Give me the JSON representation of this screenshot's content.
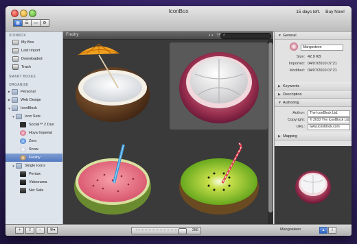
{
  "window": {
    "title": "IconBox",
    "trial_text": "15 days left.",
    "buy_label": "Buy Now!"
  },
  "toolbar": {
    "buttons": [
      "view-grid",
      "view-list",
      "view-cover",
      "settings"
    ]
  },
  "sidebar": {
    "library_header": "ICONBOX",
    "library_items": [
      "My Box",
      "Last Import",
      "Downloaded",
      "Trash"
    ],
    "smart_header": "SMART BOXES",
    "organize_header": "ORGANIZE",
    "organize_items": [
      "Personal",
      "Web Design",
      "IconBlock",
      "Icon Sets",
      "Social™ 2 Duo",
      "Hoya Imperial",
      "Zero",
      "Snow",
      "Freshy",
      "Single Icons",
      "Pentax",
      "Videorama",
      "Net Safe"
    ],
    "selected": "Freshy"
  },
  "content": {
    "title": "Freshy",
    "search_placeholder": "",
    "icons": [
      "coconut",
      "mangosteen",
      "guava",
      "kiwi"
    ],
    "selected_icon": "mangosteen"
  },
  "inspector": {
    "general_label": "General",
    "name_value": "Mangosteen",
    "size_label": "Size:",
    "size_value": "42.9 KB",
    "imported_label": "Imported:",
    "imported_value": "04/07/2010 07:21",
    "modified_label": "Modified:",
    "modified_value": "04/07/2010 07:21",
    "keywords_label": "Keywords",
    "description_label": "Description",
    "authoring_label": "Authoring",
    "author_label": "Author:",
    "author_value": "The IconBlock Ltd.",
    "copyright_label": "Copyright:",
    "copyright_value": "© 2010 The IconBlock Ltd",
    "url_label": "URL:",
    "url_value": "www.iconblock.com",
    "mapping_label": "Mapping"
  },
  "bottombar": {
    "add_label": "+",
    "import_label": "⇪",
    "remove_label": "−",
    "action_label": "✲▾",
    "size_value": "256",
    "selection_name": "Mangosteen",
    "info_label": "i"
  },
  "colors": {
    "selection": "#5278c0",
    "content_bg": "#3a3a3a",
    "inspector_bg": "#e2e2e2"
  }
}
